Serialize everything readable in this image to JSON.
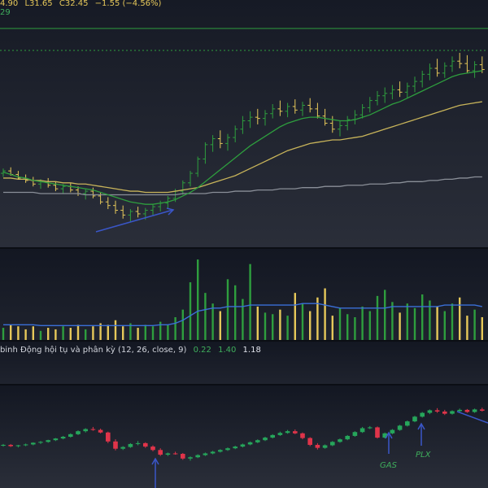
{
  "header": {
    "h_value": "4.90",
    "l_label": "L",
    "l_value": "31.65",
    "c_label": "C",
    "c_value": "32.45",
    "change": "−1.55 (−4.56%)",
    "sub_legend": "29"
  },
  "macd": {
    "title": "binh Động hội tụ và phân kỳ (12, 26, close, 9)",
    "v1": "0.22",
    "v2": "1.40",
    "v3": "1.18"
  },
  "annotations": {
    "gas": "GAS",
    "plx": "PLX"
  },
  "colors": {
    "background": "#131722",
    "up": "#2e9e3e",
    "down": "#e6c85a",
    "ma_green": "#2e9e3e",
    "ma_yellow": "#c8b45a",
    "ma_gray": "#8a8f98",
    "volume_ma": "#3a6fd8",
    "arrow": "#3a56c8",
    "index_up": "#26a65b",
    "index_down": "#e0344a"
  },
  "chart_data": [
    {
      "type": "ohlc",
      "panel": "price",
      "bars": [
        [
          32.2,
          32.6,
          31.9,
          32.4
        ],
        [
          32.4,
          32.7,
          32.0,
          32.1
        ],
        [
          32.1,
          32.4,
          31.7,
          31.8
        ],
        [
          31.8,
          32.1,
          31.4,
          31.6
        ],
        [
          31.6,
          31.9,
          31.1,
          31.3
        ],
        [
          31.3,
          31.7,
          30.9,
          31.5
        ],
        [
          31.5,
          31.8,
          31.0,
          31.2
        ],
        [
          31.2,
          31.5,
          30.7,
          30.9
        ],
        [
          30.9,
          31.3,
          30.5,
          31.1
        ],
        [
          31.1,
          31.4,
          30.6,
          30.8
        ],
        [
          30.8,
          31.1,
          30.3,
          30.5
        ],
        [
          30.5,
          30.9,
          30.0,
          30.7
        ],
        [
          30.7,
          31.0,
          30.1,
          30.3
        ],
        [
          30.3,
          30.6,
          29.6,
          29.8
        ],
        [
          29.8,
          30.2,
          29.2,
          29.5
        ],
        [
          29.5,
          29.9,
          28.8,
          29.1
        ],
        [
          29.1,
          29.5,
          28.4,
          28.7
        ],
        [
          28.7,
          29.2,
          28.1,
          29.0
        ],
        [
          29.0,
          29.4,
          28.5,
          28.8
        ],
        [
          28.8,
          29.3,
          28.3,
          29.1
        ],
        [
          29.1,
          29.6,
          28.7,
          29.4
        ],
        [
          29.4,
          29.9,
          29.0,
          29.7
        ],
        [
          29.7,
          30.3,
          29.3,
          30.1
        ],
        [
          30.1,
          30.9,
          29.8,
          30.7
        ],
        [
          30.7,
          31.6,
          30.4,
          31.4
        ],
        [
          31.4,
          32.4,
          31.1,
          32.2
        ],
        [
          32.2,
          33.6,
          31.9,
          33.4
        ],
        [
          33.4,
          34.8,
          33.0,
          34.6
        ],
        [
          34.6,
          35.4,
          34.0,
          35.1
        ],
        [
          35.1,
          35.8,
          34.3,
          34.7
        ],
        [
          34.7,
          35.5,
          34.1,
          35.2
        ],
        [
          35.2,
          36.2,
          34.8,
          35.9
        ],
        [
          35.9,
          37.0,
          35.5,
          36.6
        ],
        [
          36.6,
          37.4,
          36.0,
          36.9
        ],
        [
          36.9,
          37.6,
          36.3,
          36.8
        ],
        [
          36.8,
          37.5,
          36.2,
          37.2
        ],
        [
          37.2,
          38.0,
          36.8,
          37.6
        ],
        [
          37.6,
          38.3,
          37.0,
          37.4
        ],
        [
          37.4,
          38.1,
          36.9,
          37.8
        ],
        [
          37.8,
          38.4,
          37.2,
          37.5
        ],
        [
          37.5,
          38.2,
          37.0,
          37.9
        ],
        [
          37.9,
          38.5,
          37.3,
          37.6
        ],
        [
          37.6,
          38.1,
          36.8,
          37.0
        ],
        [
          37.0,
          37.6,
          36.2,
          36.4
        ],
        [
          36.4,
          37.0,
          35.6,
          35.9
        ],
        [
          35.9,
          36.6,
          35.3,
          36.2
        ],
        [
          36.2,
          37.0,
          35.8,
          36.7
        ],
        [
          36.7,
          37.5,
          36.3,
          37.1
        ],
        [
          37.1,
          38.0,
          36.8,
          37.7
        ],
        [
          37.7,
          38.6,
          37.3,
          38.3
        ],
        [
          38.3,
          39.1,
          37.9,
          38.7
        ],
        [
          38.7,
          39.4,
          38.1,
          38.9
        ],
        [
          38.9,
          39.6,
          38.4,
          39.2
        ],
        [
          39.2,
          39.9,
          38.6,
          39.0
        ],
        [
          39.0,
          39.8,
          38.5,
          39.5
        ],
        [
          39.5,
          40.3,
          39.0,
          39.9
        ],
        [
          39.9,
          40.8,
          39.4,
          40.5
        ],
        [
          40.5,
          41.4,
          40.0,
          41.0
        ],
        [
          41.0,
          41.8,
          40.3,
          40.6
        ],
        [
          40.6,
          41.5,
          40.2,
          41.2
        ],
        [
          41.2,
          42.0,
          40.7,
          41.6
        ],
        [
          41.6,
          42.3,
          41.0,
          41.4
        ],
        [
          41.4,
          42.1,
          40.6,
          40.8
        ],
        [
          40.8,
          41.6,
          40.2,
          41.3
        ],
        [
          41.3,
          42.0,
          40.6,
          40.9
        ]
      ],
      "ma_green": [
        32.3,
        32.1,
        31.9,
        31.8,
        31.6,
        31.5,
        31.4,
        31.3,
        31.2,
        31.1,
        31.0,
        30.9,
        30.8,
        30.6,
        30.4,
        30.2,
        30.0,
        29.8,
        29.7,
        29.6,
        29.6,
        29.7,
        29.8,
        30.0,
        30.3,
        30.6,
        31.0,
        31.5,
        32.0,
        32.5,
        33.0,
        33.5,
        34.0,
        34.5,
        34.9,
        35.3,
        35.7,
        36.1,
        36.4,
        36.6,
        36.8,
        36.9,
        36.9,
        36.8,
        36.7,
        36.6,
        36.6,
        36.7,
        36.9,
        37.1,
        37.4,
        37.7,
        38.0,
        38.2,
        38.5,
        38.8,
        39.1,
        39.4,
        39.7,
        40.0,
        40.3,
        40.5,
        40.6,
        40.7,
        40.8
      ],
      "ma_yellow": [
        31.8,
        31.8,
        31.7,
        31.7,
        31.6,
        31.6,
        31.5,
        31.5,
        31.4,
        31.4,
        31.3,
        31.3,
        31.2,
        31.1,
        31.0,
        30.9,
        30.8,
        30.7,
        30.7,
        30.6,
        30.6,
        30.6,
        30.6,
        30.7,
        30.8,
        30.9,
        31.0,
        31.2,
        31.4,
        31.6,
        31.8,
        32.0,
        32.3,
        32.6,
        32.9,
        33.2,
        33.5,
        33.8,
        34.1,
        34.3,
        34.5,
        34.7,
        34.8,
        34.9,
        35.0,
        35.0,
        35.1,
        35.2,
        35.3,
        35.5,
        35.7,
        35.9,
        36.1,
        36.3,
        36.5,
        36.7,
        36.9,
        37.1,
        37.3,
        37.5,
        37.7,
        37.9,
        38.0,
        38.1,
        38.2
      ],
      "ma_gray": [
        30.6,
        30.6,
        30.6,
        30.6,
        30.6,
        30.5,
        30.5,
        30.5,
        30.5,
        30.5,
        30.5,
        30.4,
        30.4,
        30.4,
        30.4,
        30.4,
        30.4,
        30.4,
        30.4,
        30.4,
        30.4,
        30.4,
        30.4,
        30.4,
        30.5,
        30.5,
        30.5,
        30.5,
        30.6,
        30.6,
        30.6,
        30.7,
        30.7,
        30.7,
        30.8,
        30.8,
        30.8,
        30.9,
        30.9,
        30.9,
        31.0,
        31.0,
        31.0,
        31.1,
        31.1,
        31.1,
        31.2,
        31.2,
        31.2,
        31.3,
        31.3,
        31.3,
        31.4,
        31.4,
        31.5,
        31.5,
        31.5,
        31.6,
        31.6,
        31.7,
        31.7,
        31.8,
        31.8,
        31.9,
        31.9
      ],
      "ylim": [
        26.0,
        44.0
      ]
    },
    {
      "type": "bar",
      "panel": "volume",
      "values": [
        0.8,
        1.0,
        0.9,
        0.7,
        0.9,
        0.6,
        0.8,
        0.7,
        0.9,
        0.8,
        1.0,
        0.7,
        0.9,
        1.1,
        1.0,
        1.3,
        0.9,
        1.1,
        0.8,
        1.0,
        0.9,
        1.2,
        1.0,
        1.5,
        2.0,
        3.8,
        5.3,
        3.1,
        2.4,
        1.9,
        4.0,
        3.6,
        2.7,
        5.0,
        2.2,
        1.8,
        1.7,
        2.0,
        1.6,
        3.1,
        2.4,
        1.9,
        2.8,
        3.4,
        1.6,
        2.1,
        1.7,
        1.5,
        2.2,
        1.9,
        2.9,
        3.3,
        2.5,
        1.8,
        2.4,
        2.1,
        3.0,
        2.6,
        2.2,
        1.9,
        2.4,
        2.8,
        1.6,
        2.0,
        1.5
      ],
      "ma": [
        1.0,
        1.0,
        1.0,
        1.0,
        1.0,
        0.95,
        0.95,
        0.95,
        0.95,
        0.95,
        0.95,
        0.95,
        0.95,
        0.95,
        0.95,
        0.95,
        0.95,
        0.95,
        0.95,
        0.95,
        0.95,
        1.0,
        1.0,
        1.1,
        1.3,
        1.6,
        1.9,
        2.0,
        2.1,
        2.1,
        2.2,
        2.2,
        2.2,
        2.3,
        2.3,
        2.3,
        2.3,
        2.3,
        2.3,
        2.3,
        2.4,
        2.4,
        2.4,
        2.3,
        2.2,
        2.1,
        2.1,
        2.1,
        2.1,
        2.1,
        2.1,
        2.1,
        2.2,
        2.2,
        2.2,
        2.2,
        2.2,
        2.2,
        2.2,
        2.3,
        2.3,
        2.3,
        2.3,
        2.3,
        2.2
      ],
      "ylim": [
        0,
        6
      ]
    },
    {
      "type": "candlestick",
      "panel": "index",
      "bars": [
        [
          50.0,
          50.3,
          49.7,
          50.1
        ],
        [
          50.1,
          50.3,
          49.6,
          49.8
        ],
        [
          49.8,
          50.1,
          49.5,
          50.0
        ],
        [
          50.0,
          50.4,
          49.8,
          50.2
        ],
        [
          50.2,
          50.7,
          50.0,
          50.6
        ],
        [
          50.6,
          51.0,
          50.3,
          50.8
        ],
        [
          50.8,
          51.3,
          50.6,
          51.2
        ],
        [
          51.2,
          51.7,
          51.0,
          51.6
        ],
        [
          51.6,
          52.2,
          51.4,
          52.0
        ],
        [
          52.0,
          52.8,
          51.8,
          52.6
        ],
        [
          52.6,
          53.5,
          52.4,
          53.3
        ],
        [
          53.3,
          54.0,
          53.0,
          53.8
        ],
        [
          53.8,
          54.3,
          53.4,
          53.6
        ],
        [
          53.6,
          53.9,
          52.8,
          53.0
        ],
        [
          53.0,
          53.2,
          50.5,
          50.9
        ],
        [
          50.9,
          51.4,
          48.8,
          49.2
        ],
        [
          49.2,
          49.8,
          48.9,
          49.6
        ],
        [
          49.6,
          50.5,
          49.4,
          50.3
        ],
        [
          50.3,
          51.0,
          50.0,
          50.5
        ],
        [
          50.5,
          50.7,
          49.4,
          49.7
        ],
        [
          49.7,
          50.0,
          48.6,
          48.9
        ],
        [
          48.9,
          49.3,
          47.5,
          47.8
        ],
        [
          47.8,
          48.3,
          47.5,
          48.1
        ],
        [
          48.1,
          48.5,
          47.8,
          48.0
        ],
        [
          48.0,
          48.2,
          46.6,
          46.9
        ],
        [
          46.9,
          47.4,
          46.4,
          47.2
        ],
        [
          47.2,
          47.9,
          47.0,
          47.7
        ],
        [
          47.7,
          48.3,
          47.5,
          48.1
        ],
        [
          48.1,
          48.7,
          47.9,
          48.5
        ],
        [
          48.5,
          49.1,
          48.3,
          48.9
        ],
        [
          48.9,
          49.5,
          48.7,
          49.3
        ],
        [
          49.3,
          49.9,
          49.1,
          49.7
        ],
        [
          49.7,
          50.4,
          49.5,
          50.2
        ],
        [
          50.2,
          50.9,
          50.0,
          50.7
        ],
        [
          50.7,
          51.4,
          50.5,
          51.2
        ],
        [
          51.2,
          52.0,
          51.0,
          51.8
        ],
        [
          51.8,
          52.6,
          51.6,
          52.4
        ],
        [
          52.4,
          53.2,
          52.2,
          52.9
        ],
        [
          52.9,
          53.6,
          52.7,
          53.3
        ],
        [
          53.3,
          53.7,
          52.6,
          52.8
        ],
        [
          52.8,
          53.0,
          51.4,
          51.7
        ],
        [
          51.7,
          51.9,
          49.8,
          50.1
        ],
        [
          50.1,
          50.5,
          49.0,
          49.4
        ],
        [
          49.4,
          50.2,
          49.2,
          50.0
        ],
        [
          50.0,
          51.0,
          49.8,
          50.8
        ],
        [
          50.8,
          51.6,
          50.6,
          51.4
        ],
        [
          51.4,
          52.4,
          51.2,
          52.2
        ],
        [
          52.2,
          53.3,
          52.0,
          53.1
        ],
        [
          53.1,
          54.3,
          52.9,
          54.0
        ],
        [
          54.0,
          54.5,
          53.8,
          54.2
        ],
        [
          54.2,
          54.4,
          51.6,
          51.8
        ],
        [
          51.8,
          53.0,
          51.6,
          52.8
        ],
        [
          52.8,
          53.8,
          52.6,
          53.6
        ],
        [
          53.6,
          54.8,
          53.4,
          54.6
        ],
        [
          54.6,
          55.8,
          54.4,
          55.6
        ],
        [
          55.6,
          56.9,
          55.4,
          56.7
        ],
        [
          56.7,
          57.8,
          56.5,
          57.6
        ],
        [
          57.6,
          58.4,
          57.3,
          58.2
        ],
        [
          58.2,
          58.7,
          57.6,
          57.9
        ],
        [
          57.9,
          58.3,
          57.1,
          57.4
        ],
        [
          57.4,
          58.2,
          57.2,
          58.0
        ],
        [
          58.0,
          58.6,
          57.8,
          58.3
        ],
        [
          58.3,
          58.5,
          57.6,
          57.8
        ],
        [
          57.8,
          58.6,
          57.6,
          58.4
        ],
        [
          58.4,
          58.8,
          57.9,
          58.1
        ]
      ],
      "annotations": [
        {
          "bar": 47,
          "label": "GAS"
        },
        {
          "bar": 53,
          "label": "PLX"
        }
      ],
      "ylim": [
        40.0,
        64.0
      ]
    }
  ]
}
